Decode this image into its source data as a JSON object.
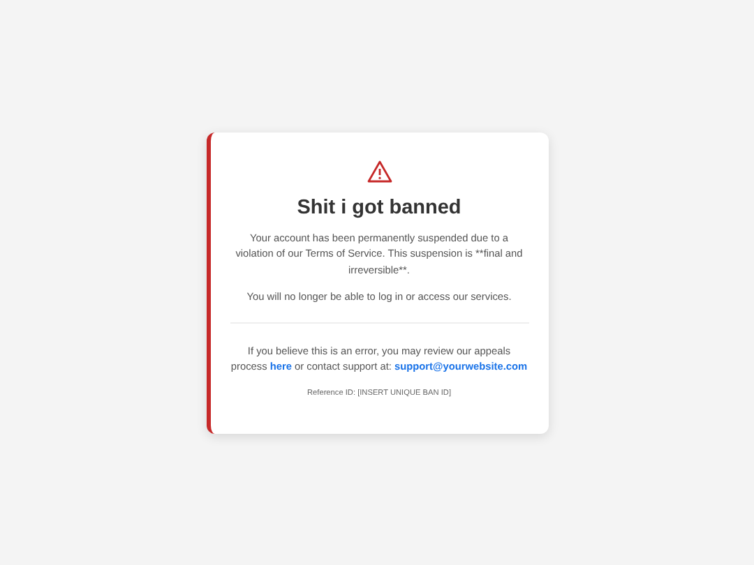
{
  "card": {
    "title": "Shit i got banned",
    "message": "Your account has been permanently suspended due to a violation of our Terms of Service. This suspension is **final and irreversible**.",
    "notice": "You will no longer be able to log in or access our services.",
    "appeal": {
      "before": "If you believe this is an error, you may review our appeals process",
      "link": "here",
      "middle": "or contact support at:",
      "email": "support@yourwebsite.com"
    },
    "reference": "Reference ID: [INSERT UNIQUE BAN ID]"
  }
}
